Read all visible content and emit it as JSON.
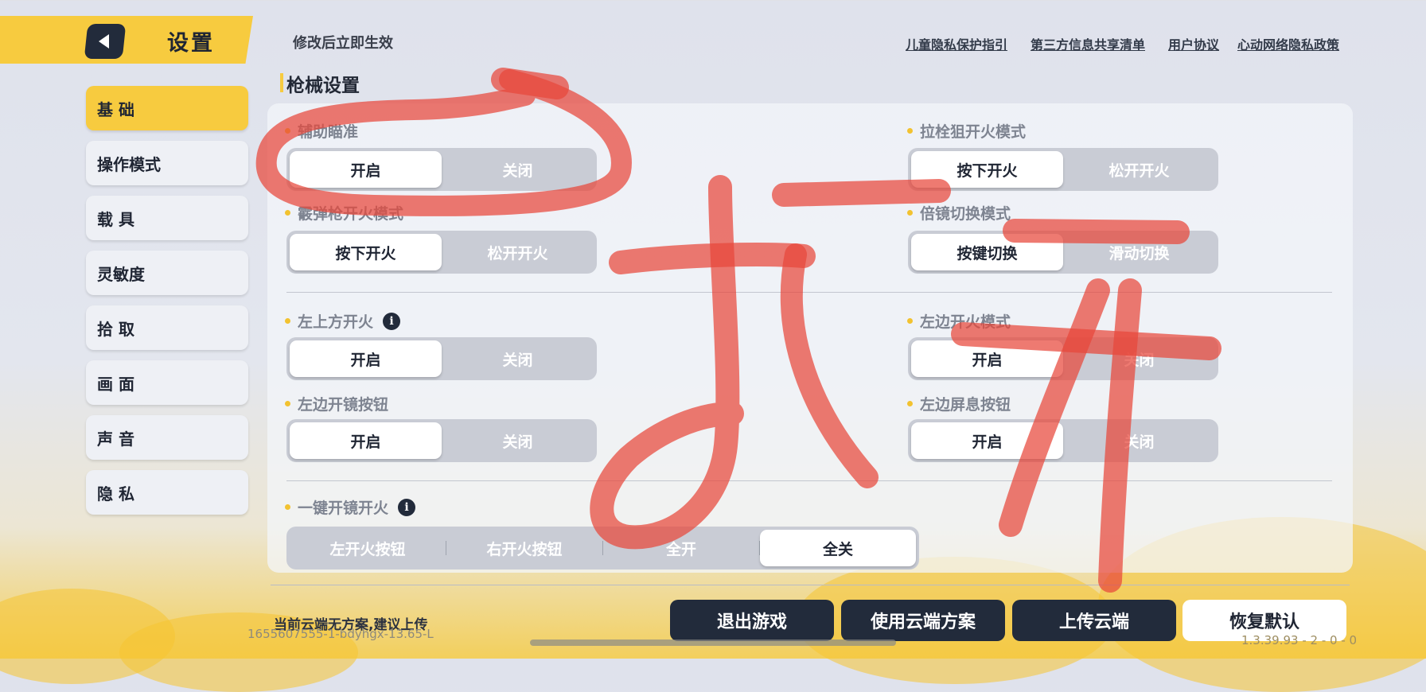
{
  "header": {
    "title": "设置",
    "notice": "修改后立即生效",
    "back_icon": "back-arrow-icon"
  },
  "top_links": [
    "儿童隐私保护指引",
    "第三方信息共享清单",
    "用户协议",
    "心动网络隐私政策"
  ],
  "sidebar": {
    "active": "基 础",
    "items": [
      "基 础",
      "操作模式",
      "载 具",
      "灵敏度",
      "拾 取",
      "画 面",
      "声 音",
      "隐 私"
    ]
  },
  "section": {
    "title": "枪械设置"
  },
  "options": {
    "aim_assist": {
      "label": "辅助瞄准",
      "choices": [
        "开启",
        "关闭"
      ],
      "selected": "开启"
    },
    "bolt_sniper": {
      "label": "拉栓狙开火模式",
      "choices": [
        "按下开火",
        "松开开火"
      ],
      "selected": "按下开火"
    },
    "shotgun_fire": {
      "label": "霰弹枪开火模式",
      "choices": [
        "按下开火",
        "松开开火"
      ],
      "selected": "按下开火"
    },
    "scope_switch": {
      "label": "倍镜切换模式",
      "choices": [
        "按键切换",
        "滑动切换"
      ],
      "selected": "按键切换"
    },
    "top_left_fire": {
      "label": "左上方开火",
      "choices": [
        "开启",
        "关闭"
      ],
      "selected": "开启",
      "info_icon": "info-icon"
    },
    "left_fire_mode": {
      "label": "左边开火模式",
      "choices": [
        "开启",
        "关闭"
      ],
      "selected": "开启"
    },
    "left_scope_btn": {
      "label": "左边开镜按钮",
      "choices": [
        "开启",
        "关闭"
      ],
      "selected": "开启"
    },
    "left_breath_btn": {
      "label": "左边屏息按钮",
      "choices": [
        "开启",
        "关闭"
      ],
      "selected": "开启"
    },
    "one_key_scope": {
      "label": "一键开镜开火",
      "choices": [
        "左开火按钮",
        "右开火按钮",
        "全开",
        "全关"
      ],
      "selected": "全关",
      "info_icon": "info-icon"
    }
  },
  "footer": {
    "cloud_note": "当前云端无方案,建议上传",
    "build_id": "1655607555-1-bdyhgx-13.65-L",
    "version": "1.3.39.93 - 2 - 0 - 0",
    "buttons": [
      "退出游戏",
      "使用云端方案",
      "上传云端",
      "恢复默认"
    ]
  },
  "colors": {
    "accent": "#f7cb3f",
    "dark": "#222b3b",
    "scribble": "#e8473a"
  }
}
